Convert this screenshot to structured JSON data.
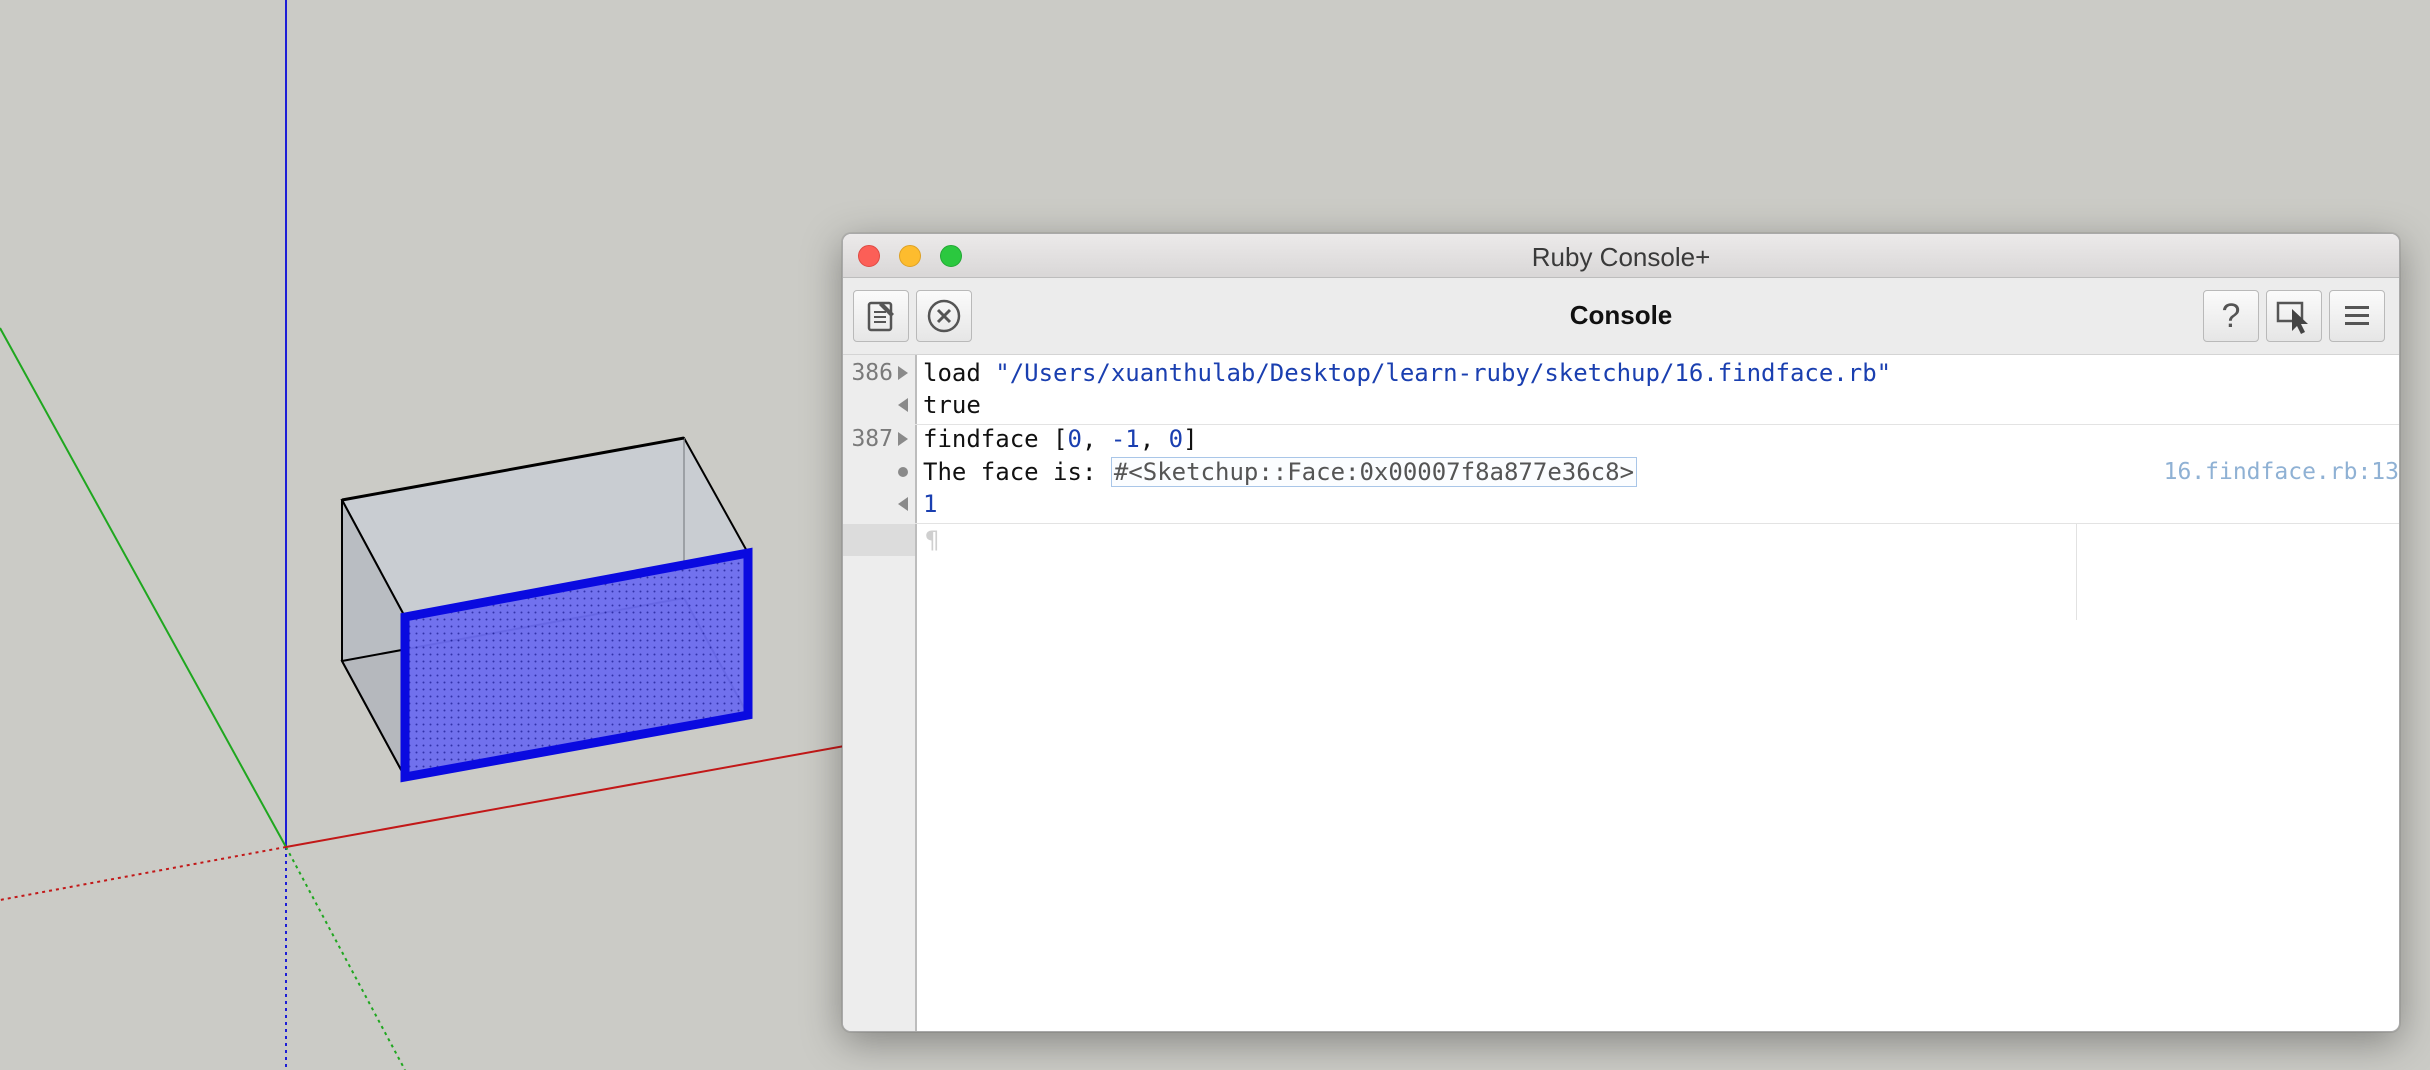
{
  "window": {
    "title": "Ruby Console+"
  },
  "toolbar": {
    "title": "Console",
    "buttons": [
      {
        "name": "editor-icon"
      },
      {
        "name": "clear-icon"
      },
      {
        "name": "help-icon"
      },
      {
        "name": "select-entity-icon"
      },
      {
        "name": "menu-icon"
      }
    ]
  },
  "console": {
    "entry_386": {
      "number": "386",
      "input_keyword": "load ",
      "input_string": "\"/Users/xuanthulab/Desktop/learn-ruby/sketchup/16.findface.rb\"",
      "result": "true"
    },
    "entry_387": {
      "number": "387",
      "input_fn": "findface [",
      "arg1": "0",
      "comma1": ", ",
      "arg2": "-1",
      "comma2": ", ",
      "arg3": "0",
      "close": "]",
      "output_prefix": "The face is: ",
      "output_object": "#<Sketchup::Face:0x00007f8a877e36c8>",
      "output_source": "16.findface.rb:13",
      "result": "1"
    },
    "input_placeholder": "¶"
  },
  "colors": {
    "viewport_bg": "#cbcbc6",
    "axis_blue": "#1d1dd6",
    "axis_green": "#1fa71f",
    "axis_red": "#c21818",
    "selection_blue": "#0a0ae0",
    "string_blue": "#1a3fb0"
  }
}
